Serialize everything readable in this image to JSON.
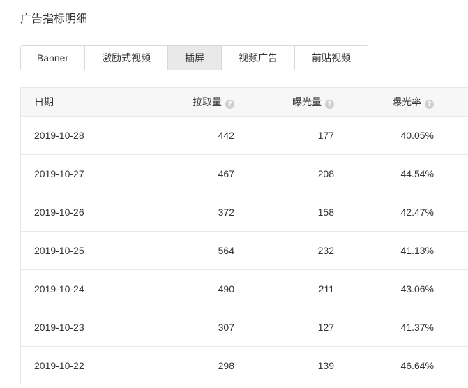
{
  "page": {
    "title": "广告指标明细"
  },
  "tabs": [
    {
      "label": "Banner",
      "active": false
    },
    {
      "label": "激励式视频",
      "active": false
    },
    {
      "label": "插屏",
      "active": true
    },
    {
      "label": "视频广告",
      "active": false
    },
    {
      "label": "前贴视频",
      "active": false
    }
  ],
  "table": {
    "headers": {
      "date": "日期",
      "pull": "拉取量",
      "exposure": "曝光量",
      "rate": "曝光率"
    },
    "rows": [
      {
        "date": "2019-10-28",
        "pull": "442",
        "exposure": "177",
        "rate": "40.05%"
      },
      {
        "date": "2019-10-27",
        "pull": "467",
        "exposure": "208",
        "rate": "44.54%"
      },
      {
        "date": "2019-10-26",
        "pull": "372",
        "exposure": "158",
        "rate": "42.47%"
      },
      {
        "date": "2019-10-25",
        "pull": "564",
        "exposure": "232",
        "rate": "41.13%"
      },
      {
        "date": "2019-10-24",
        "pull": "490",
        "exposure": "211",
        "rate": "43.06%"
      },
      {
        "date": "2019-10-23",
        "pull": "307",
        "exposure": "127",
        "rate": "41.37%"
      },
      {
        "date": "2019-10-22",
        "pull": "298",
        "exposure": "139",
        "rate": "46.64%"
      }
    ]
  },
  "icons": {
    "help": "question-circle-icon"
  },
  "colors": {
    "active_tab_bg": "#e9e9e9",
    "header_bg": "#f7f7f7",
    "border": "#e8e8e8"
  }
}
